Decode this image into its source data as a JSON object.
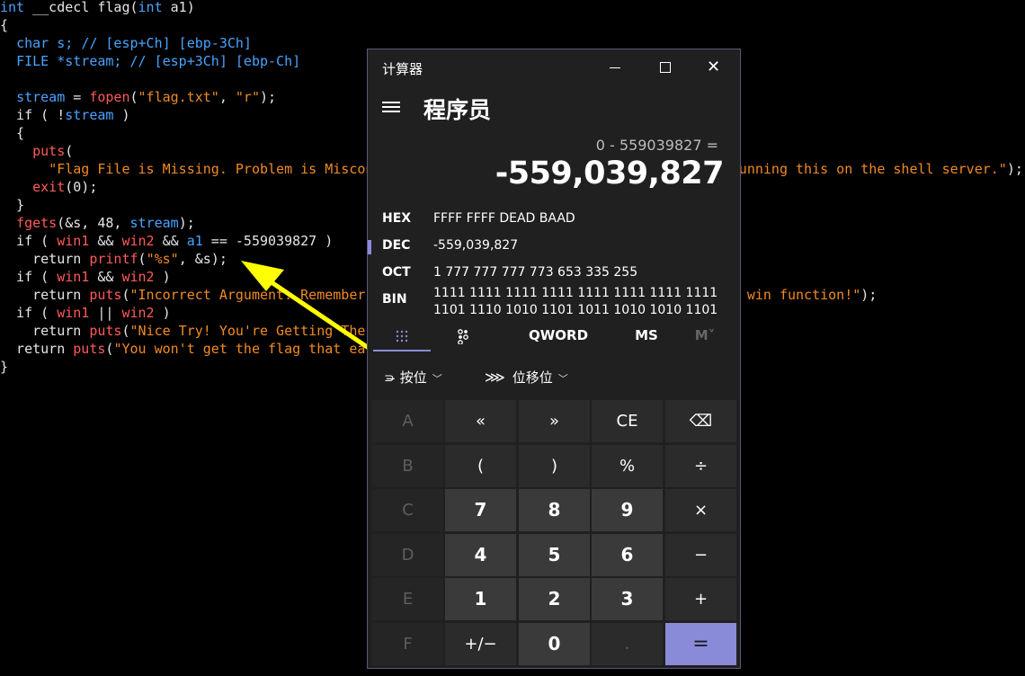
{
  "code_lines": [
    [
      [
        "int ",
        "kw"
      ],
      [
        "__cdecl flag(",
        "pl"
      ],
      [
        "int ",
        "kw"
      ],
      [
        "a1)",
        "pl"
      ]
    ],
    [
      [
        "{",
        "pl"
      ]
    ],
    [
      [
        "  ",
        "pl"
      ],
      [
        "char ",
        "kw"
      ],
      [
        "s; ",
        "id"
      ],
      [
        "// [esp+Ch] [ebp-3Ch]",
        "cm"
      ]
    ],
    [
      [
        "  ",
        "pl"
      ],
      [
        "FILE *stream; ",
        "id"
      ],
      [
        "// [esp+3Ch] [ebp-Ch]",
        "cm"
      ]
    ],
    [
      [
        "",
        "pl"
      ]
    ],
    [
      [
        "  ",
        "pl"
      ],
      [
        "stream",
        "id"
      ],
      [
        " = ",
        "pl"
      ],
      [
        "fopen",
        "fn"
      ],
      [
        "(",
        "pl"
      ],
      [
        "\"flag.txt\"",
        "str"
      ],
      [
        ", ",
        "pl"
      ],
      [
        "\"r\"",
        "str"
      ],
      [
        ");",
        "pl"
      ]
    ],
    [
      [
        "  if ( !",
        "pl"
      ],
      [
        "stream",
        "id"
      ],
      [
        " )",
        "pl"
      ]
    ],
    [
      [
        "  {",
        "pl"
      ]
    ],
    [
      [
        "    ",
        "pl"
      ],
      [
        "puts",
        "fn"
      ],
      [
        "(",
        "pl"
      ]
    ],
    [
      [
        "      ",
        "pl"
      ],
      [
        "\"Flag File is Missing. Problem is Misconfigured, please contact an Admin if you are running this on the shell server.\"",
        "str"
      ],
      [
        ");",
        "pl"
      ]
    ],
    [
      [
        "    ",
        "pl"
      ],
      [
        "exit",
        "fn"
      ],
      [
        "(0);",
        "pl"
      ]
    ],
    [
      [
        "  }",
        "pl"
      ]
    ],
    [
      [
        "  ",
        "pl"
      ],
      [
        "fgets",
        "fn"
      ],
      [
        "(&s, 48, ",
        "pl"
      ],
      [
        "stream",
        "id"
      ],
      [
        ");",
        "pl"
      ]
    ],
    [
      [
        "  if ( ",
        "pl"
      ],
      [
        "win1",
        "var"
      ],
      [
        " && ",
        "pl"
      ],
      [
        "win2",
        "var"
      ],
      [
        " && ",
        "pl"
      ],
      [
        "a1",
        "id"
      ],
      [
        " == -559039827 )",
        "pl"
      ]
    ],
    [
      [
        "    return ",
        "pl"
      ],
      [
        "printf",
        "fn"
      ],
      [
        "(",
        "pl"
      ],
      [
        "\"%s\"",
        "str"
      ],
      [
        ", &s);",
        "pl"
      ]
    ],
    [
      [
        "  if ( ",
        "pl"
      ],
      [
        "win1",
        "var"
      ],
      [
        " && ",
        "pl"
      ],
      [
        "win2",
        "var"
      ],
      [
        " )",
        "pl"
      ]
    ],
    [
      [
        "    return ",
        "pl"
      ],
      [
        "puts",
        "fn"
      ],
      [
        "(",
        "pl"
      ],
      [
        "\"Incorrect Argument. Remember, you can call other functions in between each win function!\"",
        "str"
      ],
      [
        ");",
        "pl"
      ]
    ],
    [
      [
        "  if ( ",
        "pl"
      ],
      [
        "win1",
        "var"
      ],
      [
        " || ",
        "pl"
      ],
      [
        "win2",
        "var"
      ],
      [
        " )",
        "pl"
      ]
    ],
    [
      [
        "    return ",
        "pl"
      ],
      [
        "puts",
        "fn"
      ],
      [
        "(",
        "pl"
      ],
      [
        "\"Nice Try! You're Getting There!\"",
        "str"
      ],
      [
        ");",
        "pl"
      ]
    ],
    [
      [
        "  return ",
        "pl"
      ],
      [
        "puts",
        "fn"
      ],
      [
        "(",
        "pl"
      ],
      [
        "\"You won't get the flag that easy..\"",
        "str"
      ],
      [
        ");",
        "pl"
      ]
    ],
    [
      [
        "}",
        "pl"
      ]
    ]
  ],
  "calculator": {
    "window_title": "计算器",
    "mode": "程序员",
    "expression": "0 - 559039827 =",
    "result": "-559,039,827",
    "radix": [
      {
        "label": "HEX",
        "value": "FFFF FFFF DEAD BAAD",
        "selected": false
      },
      {
        "label": "DEC",
        "value": "-559,039,827",
        "selected": true
      },
      {
        "label": "OCT",
        "value": "1 777 777 777 773 653 335 255",
        "selected": false
      },
      {
        "label": "BIN",
        "value": "1111 1111 1111 1111 1111 1111 1111 1111\n1101 1110 1010 1101 1011 1010 1010 1101",
        "selected": false
      }
    ],
    "tabs": {
      "word_size": "QWORD",
      "memory_store": "MS",
      "memory_view": "M˅"
    },
    "bit_ops": {
      "bitwise": "按位",
      "bitshift": "位移位"
    },
    "keys": [
      [
        "A",
        "«",
        "»",
        "CE",
        "⌫"
      ],
      [
        "B",
        "(",
        ")",
        "%",
        "÷"
      ],
      [
        "C",
        "7",
        "8",
        "9",
        "×"
      ],
      [
        "D",
        "4",
        "5",
        "6",
        "−"
      ],
      [
        "E",
        "1",
        "2",
        "3",
        "+"
      ],
      [
        "F",
        "+/−",
        "0",
        ".",
        "="
      ]
    ]
  },
  "colors": {
    "accent": "#8a8bd8",
    "arrow": "#ffff00",
    "calc_bg": "#202020"
  }
}
